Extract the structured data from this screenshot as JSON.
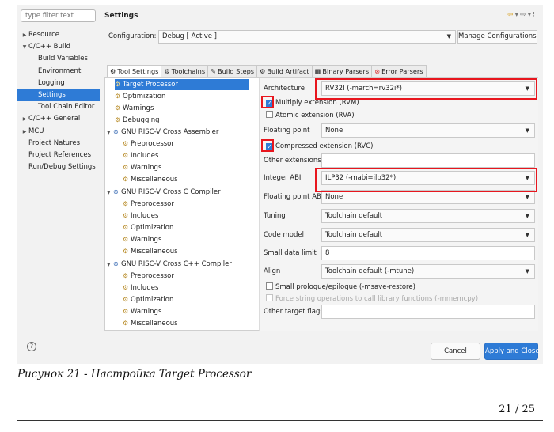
{
  "filter": {
    "placeholder": "type filter text"
  },
  "nav": [
    {
      "label": "Resource",
      "level": 0,
      "arrow": "▶"
    },
    {
      "label": "C/C++ Build",
      "level": 0,
      "arrow": "▼"
    },
    {
      "label": "Build Variables",
      "level": 1
    },
    {
      "label": "Environment",
      "level": 1
    },
    {
      "label": "Logging",
      "level": 1
    },
    {
      "label": "Settings",
      "level": 1,
      "selected": true
    },
    {
      "label": "Tool Chain Editor",
      "level": 1
    },
    {
      "label": "C/C++ General",
      "level": 0,
      "arrow": "▶"
    },
    {
      "label": "MCU",
      "level": 0,
      "arrow": "▶"
    },
    {
      "label": "Project Natures",
      "level": 0
    },
    {
      "label": "Project References",
      "level": 0
    },
    {
      "label": "Run/Debug Settings",
      "level": 0
    }
  ],
  "header": {
    "title": "Settings",
    "icons": [
      "back-arrow-icon",
      "dropdown-icon",
      "forward-arrow-icon",
      "dropdown-icon",
      "menu-icon"
    ]
  },
  "config": {
    "label": "Configuration:",
    "value": "Debug  [ Active ]",
    "manage": "Manage Configurations..."
  },
  "tabs": [
    {
      "icon": "⚙",
      "label": "Tool Settings"
    },
    {
      "icon": "⚙",
      "label": "Toolchains"
    },
    {
      "icon": "✎",
      "label": "Build Steps"
    },
    {
      "icon": "⚙",
      "label": "Build Artifact"
    },
    {
      "icon": "▦",
      "label": "Binary Parsers"
    },
    {
      "icon": "⊗",
      "label": "Error Parsers"
    }
  ],
  "tool_tree": {
    "target": "Target Processor",
    "top": [
      "Optimization",
      "Warnings",
      "Debugging"
    ],
    "groups": [
      {
        "label": "GNU RISC-V Cross Assembler",
        "children": [
          "Preprocessor",
          "Includes",
          "Warnings",
          "Miscellaneous"
        ]
      },
      {
        "label": "GNU RISC-V Cross C Compiler",
        "children": [
          "Preprocessor",
          "Includes",
          "Optimization",
          "Warnings",
          "Miscellaneous"
        ]
      },
      {
        "label": "GNU RISC-V Cross C++ Compiler",
        "children": [
          "Preprocessor",
          "Includes",
          "Optimization",
          "Warnings",
          "Miscellaneous"
        ]
      }
    ]
  },
  "options": {
    "architecture": {
      "label": "Architecture",
      "value": "RV32I (-march=rv32i*)"
    },
    "multiply": {
      "label": "Multiply extension (RVM)",
      "checked": true
    },
    "atomic": {
      "label": "Atomic extension (RVA)",
      "checked": false
    },
    "floating_point": {
      "label": "Floating point",
      "value": "None"
    },
    "compressed": {
      "label": "Compressed extension (RVC)",
      "checked": true
    },
    "other_extensions": {
      "label": "Other extensions",
      "value": ""
    },
    "integer_abi": {
      "label": "Integer ABI",
      "value": "ILP32 (-mabi=ilp32*)"
    },
    "float_abi": {
      "label": "Floating point ABI",
      "value": "None"
    },
    "tuning": {
      "label": "Tuning",
      "value": "Toolchain default"
    },
    "code_model": {
      "label": "Code model",
      "value": "Toolchain default"
    },
    "small_data": {
      "label": "Small data limit",
      "value": "8"
    },
    "align": {
      "label": "Align",
      "value": "Toolchain default (-mtune)"
    },
    "small_prologue": {
      "label": "Small prologue/epilogue (-msave-restore)",
      "checked": false
    },
    "force_string": {
      "label": "Force string operations to call library functions (-mmemcpy)",
      "checked": false
    },
    "other_target_flags": {
      "label": "Other target flags",
      "value": ""
    }
  },
  "footer": {
    "help": "?",
    "cancel": "Cancel",
    "apply": "Apply and Close"
  },
  "caption": "Рисунок 21 - Настройка Target Processor",
  "page": "21 / 25",
  "colors": {
    "accent": "#2e7bd6",
    "highlight": "#e8161e"
  }
}
